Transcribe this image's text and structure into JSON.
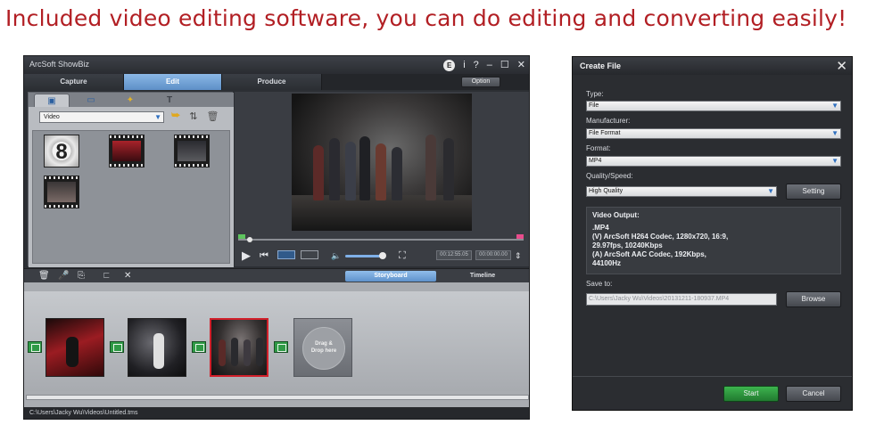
{
  "headline": "Included video editing software, you can do editing and converting easily!",
  "showbiz": {
    "title": "ArcSoft ShowBiz",
    "titlebar_icons": [
      "e-icon",
      "info-icon",
      "help-icon",
      "minimize-icon",
      "maximize-icon",
      "close-icon"
    ],
    "titlebar_glyphs": [
      "E",
      "i",
      "?",
      "–",
      "☐",
      "✕"
    ],
    "tabs": [
      "Capture",
      "Edit",
      "Produce"
    ],
    "active_tab": "Edit",
    "option_label": "Option",
    "library": {
      "tab_glyphs": [
        "▣",
        "▭",
        "✦",
        "T"
      ],
      "tab_names": [
        "media-tab-icon",
        "effects-tab-icon",
        "star-tab-icon",
        "text-tab-icon"
      ],
      "category": "Video",
      "count_thumb_label": "8",
      "actions": [
        "import-icon",
        "sort-icon",
        "delete-icon"
      ]
    },
    "player": {
      "time_current": "00:12:55.05",
      "time_total": "00:00:00.00",
      "play_icon": "▶",
      "prev_icon": "⏮",
      "volume_icon": "🔈",
      "fullscreen_icon": "⛶"
    },
    "storyboard_tools": [
      "delete-icon",
      "microphone-icon",
      "extract-icon",
      "trim-icon",
      "remove-icon"
    ],
    "storyboard_tool_glyphs": [
      "🗑",
      "🎤",
      "⎘",
      "⊏",
      "✕"
    ],
    "view_tabs": [
      "Storyboard",
      "Timeline"
    ],
    "active_view": "Storyboard",
    "drop_text_line1": "Drag &",
    "drop_text_line2": "Drop here",
    "status_path": "C:\\Users\\Jacky Wu\\Videos\\Untitled.tms"
  },
  "dialog": {
    "title": "Create File",
    "type_label": "Type:",
    "type_value": "File",
    "manufacturer_label": "Manufacturer:",
    "manufacturer_value": "File Format",
    "format_label": "Format:",
    "format_value": "MP4",
    "quality_label": "Quality/Speed:",
    "quality_value": "High Quality",
    "setting_button": "Setting",
    "output_title": "Video Output:",
    "output_lines": [
      ".MP4",
      "(V) ArcSoft H264 Codec, 1280x720, 16:9,",
      "29.97fps, 10240Kbps",
      "(A) ArcSoft AAC Codec, 192Kbps,",
      "44100Hz"
    ],
    "save_label": "Save to:",
    "save_path": "C:\\Users\\Jacky Wu\\Videos\\20131211-180937.MP4",
    "browse_button": "Browse",
    "start_button": "Start",
    "cancel_button": "Cancel",
    "dropdown_arrow": "▼"
  },
  "colors": {
    "headline": "#b21f24",
    "accent_blue": "#5d8fc7",
    "start_green": "#2f9a46",
    "selected_clip": "#d11f2a"
  }
}
